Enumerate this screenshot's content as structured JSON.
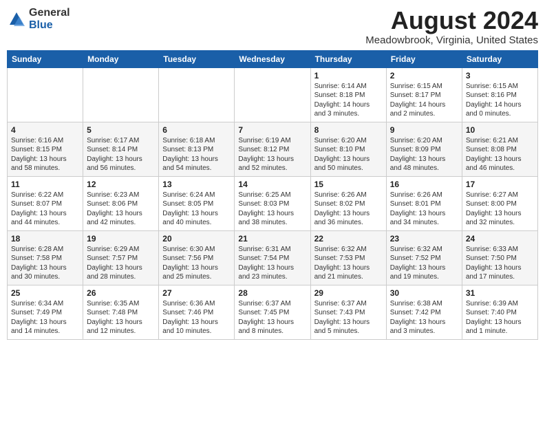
{
  "header": {
    "logo_general": "General",
    "logo_blue": "Blue",
    "month_year": "August 2024",
    "location": "Meadowbrook, Virginia, United States"
  },
  "days_of_week": [
    "Sunday",
    "Monday",
    "Tuesday",
    "Wednesday",
    "Thursday",
    "Friday",
    "Saturday"
  ],
  "weeks": [
    [
      {
        "day": "",
        "info": ""
      },
      {
        "day": "",
        "info": ""
      },
      {
        "day": "",
        "info": ""
      },
      {
        "day": "",
        "info": ""
      },
      {
        "day": "1",
        "info": "Sunrise: 6:14 AM\nSunset: 8:18 PM\nDaylight: 14 hours\nand 3 minutes."
      },
      {
        "day": "2",
        "info": "Sunrise: 6:15 AM\nSunset: 8:17 PM\nDaylight: 14 hours\nand 2 minutes."
      },
      {
        "day": "3",
        "info": "Sunrise: 6:15 AM\nSunset: 8:16 PM\nDaylight: 14 hours\nand 0 minutes."
      }
    ],
    [
      {
        "day": "4",
        "info": "Sunrise: 6:16 AM\nSunset: 8:15 PM\nDaylight: 13 hours\nand 58 minutes."
      },
      {
        "day": "5",
        "info": "Sunrise: 6:17 AM\nSunset: 8:14 PM\nDaylight: 13 hours\nand 56 minutes."
      },
      {
        "day": "6",
        "info": "Sunrise: 6:18 AM\nSunset: 8:13 PM\nDaylight: 13 hours\nand 54 minutes."
      },
      {
        "day": "7",
        "info": "Sunrise: 6:19 AM\nSunset: 8:12 PM\nDaylight: 13 hours\nand 52 minutes."
      },
      {
        "day": "8",
        "info": "Sunrise: 6:20 AM\nSunset: 8:10 PM\nDaylight: 13 hours\nand 50 minutes."
      },
      {
        "day": "9",
        "info": "Sunrise: 6:20 AM\nSunset: 8:09 PM\nDaylight: 13 hours\nand 48 minutes."
      },
      {
        "day": "10",
        "info": "Sunrise: 6:21 AM\nSunset: 8:08 PM\nDaylight: 13 hours\nand 46 minutes."
      }
    ],
    [
      {
        "day": "11",
        "info": "Sunrise: 6:22 AM\nSunset: 8:07 PM\nDaylight: 13 hours\nand 44 minutes."
      },
      {
        "day": "12",
        "info": "Sunrise: 6:23 AM\nSunset: 8:06 PM\nDaylight: 13 hours\nand 42 minutes."
      },
      {
        "day": "13",
        "info": "Sunrise: 6:24 AM\nSunset: 8:05 PM\nDaylight: 13 hours\nand 40 minutes."
      },
      {
        "day": "14",
        "info": "Sunrise: 6:25 AM\nSunset: 8:03 PM\nDaylight: 13 hours\nand 38 minutes."
      },
      {
        "day": "15",
        "info": "Sunrise: 6:26 AM\nSunset: 8:02 PM\nDaylight: 13 hours\nand 36 minutes."
      },
      {
        "day": "16",
        "info": "Sunrise: 6:26 AM\nSunset: 8:01 PM\nDaylight: 13 hours\nand 34 minutes."
      },
      {
        "day": "17",
        "info": "Sunrise: 6:27 AM\nSunset: 8:00 PM\nDaylight: 13 hours\nand 32 minutes."
      }
    ],
    [
      {
        "day": "18",
        "info": "Sunrise: 6:28 AM\nSunset: 7:58 PM\nDaylight: 13 hours\nand 30 minutes."
      },
      {
        "day": "19",
        "info": "Sunrise: 6:29 AM\nSunset: 7:57 PM\nDaylight: 13 hours\nand 28 minutes."
      },
      {
        "day": "20",
        "info": "Sunrise: 6:30 AM\nSunset: 7:56 PM\nDaylight: 13 hours\nand 25 minutes."
      },
      {
        "day": "21",
        "info": "Sunrise: 6:31 AM\nSunset: 7:54 PM\nDaylight: 13 hours\nand 23 minutes."
      },
      {
        "day": "22",
        "info": "Sunrise: 6:32 AM\nSunset: 7:53 PM\nDaylight: 13 hours\nand 21 minutes."
      },
      {
        "day": "23",
        "info": "Sunrise: 6:32 AM\nSunset: 7:52 PM\nDaylight: 13 hours\nand 19 minutes."
      },
      {
        "day": "24",
        "info": "Sunrise: 6:33 AM\nSunset: 7:50 PM\nDaylight: 13 hours\nand 17 minutes."
      }
    ],
    [
      {
        "day": "25",
        "info": "Sunrise: 6:34 AM\nSunset: 7:49 PM\nDaylight: 13 hours\nand 14 minutes."
      },
      {
        "day": "26",
        "info": "Sunrise: 6:35 AM\nSunset: 7:48 PM\nDaylight: 13 hours\nand 12 minutes."
      },
      {
        "day": "27",
        "info": "Sunrise: 6:36 AM\nSunset: 7:46 PM\nDaylight: 13 hours\nand 10 minutes."
      },
      {
        "day": "28",
        "info": "Sunrise: 6:37 AM\nSunset: 7:45 PM\nDaylight: 13 hours\nand 8 minutes."
      },
      {
        "day": "29",
        "info": "Sunrise: 6:37 AM\nSunset: 7:43 PM\nDaylight: 13 hours\nand 5 minutes."
      },
      {
        "day": "30",
        "info": "Sunrise: 6:38 AM\nSunset: 7:42 PM\nDaylight: 13 hours\nand 3 minutes."
      },
      {
        "day": "31",
        "info": "Sunrise: 6:39 AM\nSunset: 7:40 PM\nDaylight: 13 hours\nand 1 minute."
      }
    ]
  ]
}
